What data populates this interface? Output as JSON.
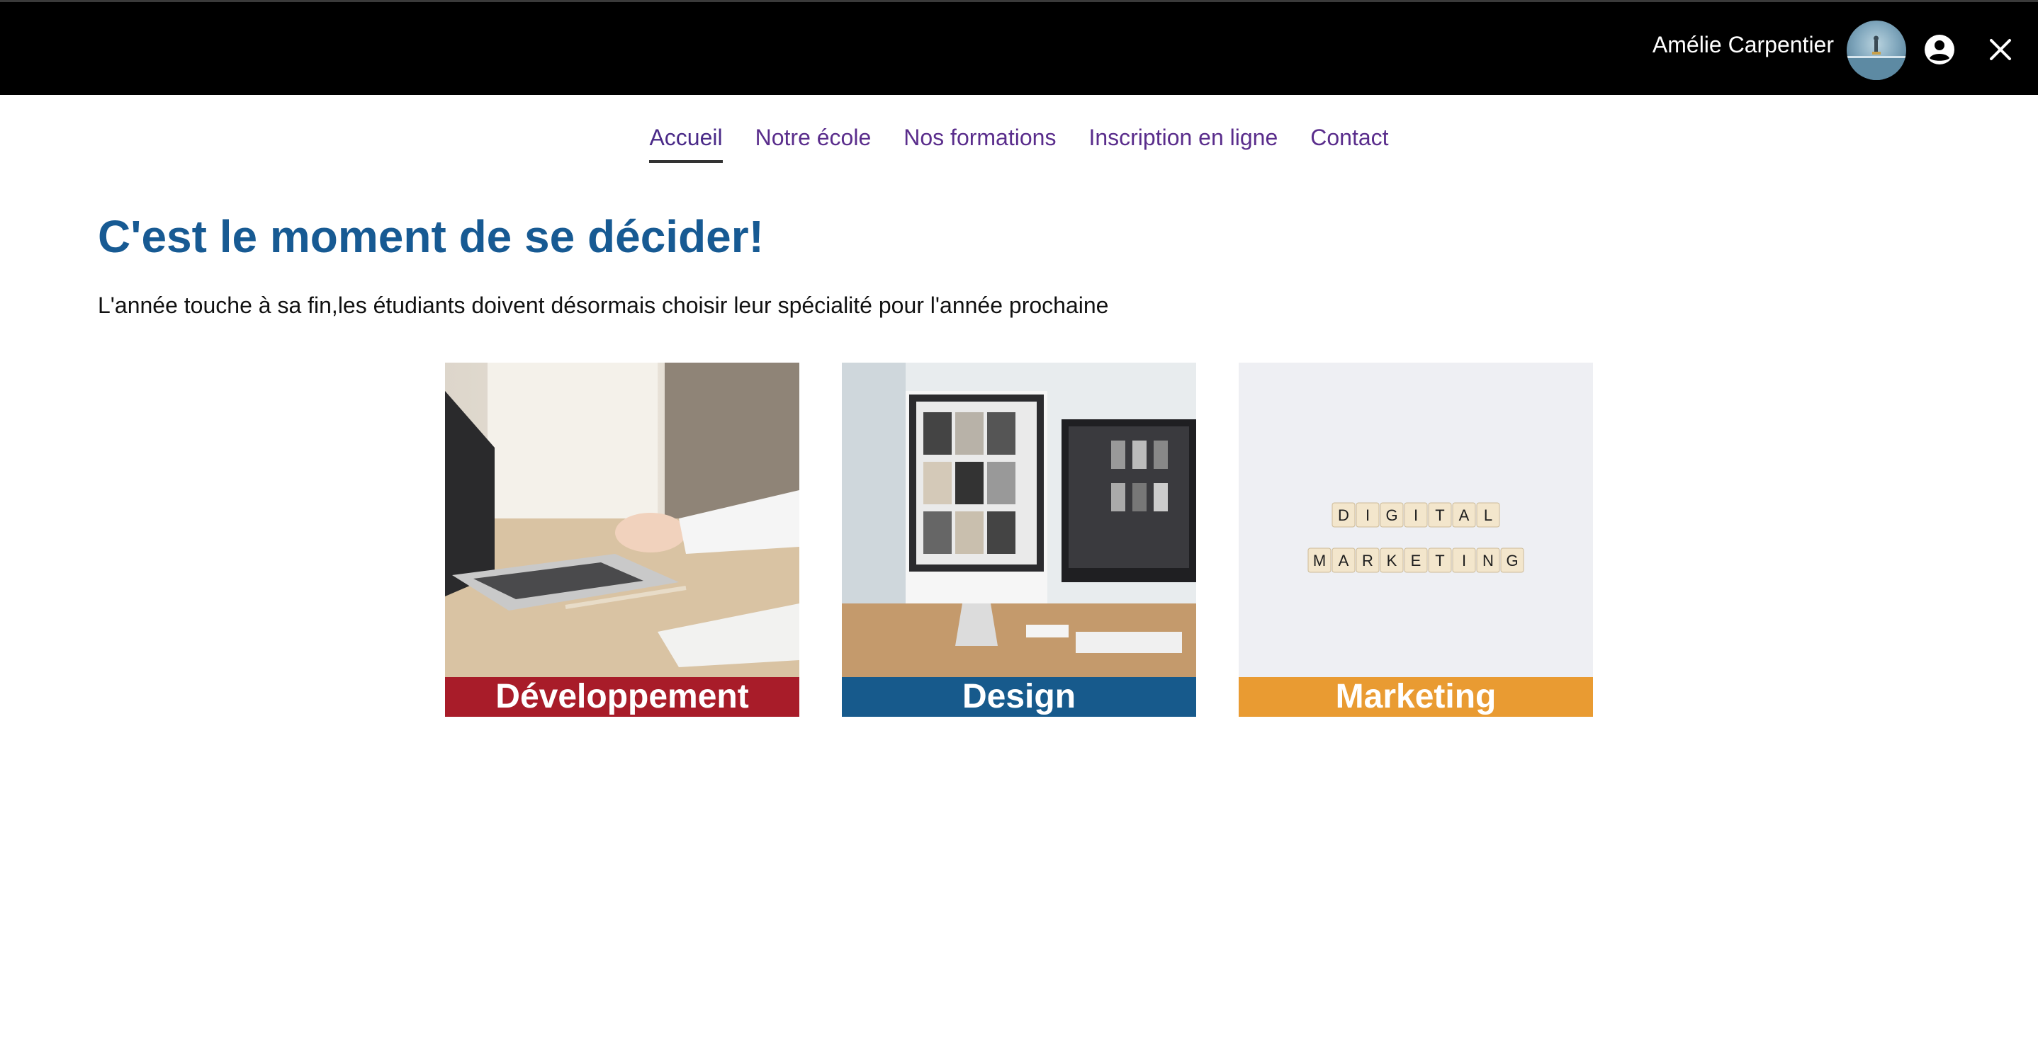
{
  "header": {
    "user_name": "Amélie Carpentier",
    "icons": {
      "avatar": "user-photo",
      "account": "account-circle-icon",
      "close": "close-icon"
    }
  },
  "nav": {
    "items": [
      {
        "label": "Accueil",
        "active": true
      },
      {
        "label": "Notre école",
        "active": false
      },
      {
        "label": "Nos formations",
        "active": false
      },
      {
        "label": "Inscription en ligne",
        "active": false
      },
      {
        "label": "Contact",
        "active": false
      }
    ]
  },
  "main": {
    "title": "C'est le moment de se décider!",
    "intro": "L'année touche à sa fin,les étudiants doivent désormais choisir leur spécialité pour l'année prochaine",
    "cards": [
      {
        "label": "Développement",
        "color": "#a81c29"
      },
      {
        "label": "Design",
        "color": "#175a8c"
      },
      {
        "label": "Marketing",
        "color": "#e99b32"
      }
    ],
    "marketing_tiles": [
      "DIGITAL",
      "MARKETING"
    ]
  },
  "colors": {
    "topbar": "#000000",
    "nav_link": "#5a2d8c",
    "heading": "#175a93"
  }
}
